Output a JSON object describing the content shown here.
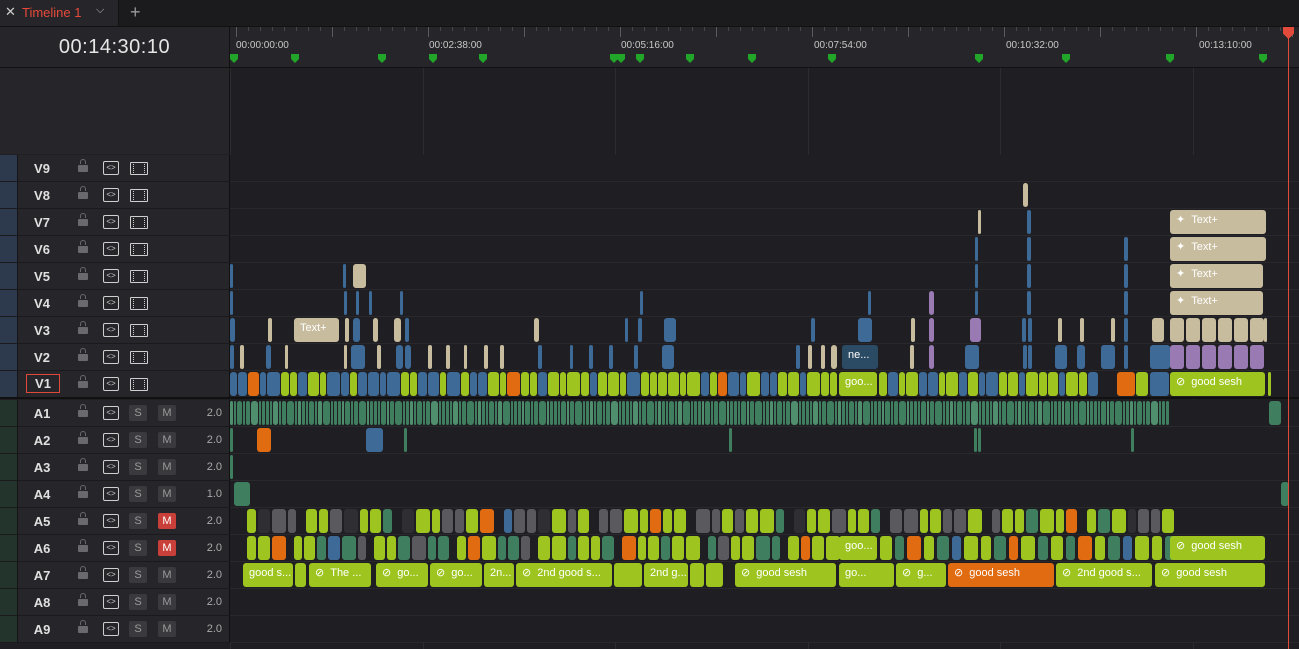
{
  "tab": {
    "close_glyph": "✕",
    "title": "Timeline 1",
    "chevron": "⌵",
    "add": "+"
  },
  "timecode": "00:14:30:10",
  "ruler_labels": [
    "00:00:00:00",
    "00:02:38:00",
    "00:05:16:00",
    "00:07:54:00",
    "00:10:32:00",
    "00:13:10:00"
  ],
  "colors": {
    "accent_red": "#e24a3c",
    "marker_green": "#21a62a",
    "lime": "#9ec51f",
    "blue": "#3d6a96",
    "orange": "#e06b10",
    "beige": "#c8bc9e",
    "purple": "#9a7ab2",
    "audio_green": "#3f7e5f"
  },
  "video_tracks": [
    {
      "name": "V9"
    },
    {
      "name": "V8"
    },
    {
      "name": "V7"
    },
    {
      "name": "V6"
    },
    {
      "name": "V5"
    },
    {
      "name": "V4"
    },
    {
      "name": "V3"
    },
    {
      "name": "V2"
    },
    {
      "name": "V1",
      "selected": true
    }
  ],
  "audio_tracks": [
    {
      "name": "A1",
      "solo": "S",
      "mute": "M",
      "muted": false,
      "level": "2.0"
    },
    {
      "name": "A2",
      "solo": "S",
      "mute": "M",
      "muted": false,
      "level": "2.0"
    },
    {
      "name": "A3",
      "solo": "S",
      "mute": "M",
      "muted": false,
      "level": "2.0"
    },
    {
      "name": "A4",
      "solo": "S",
      "mute": "M",
      "muted": false,
      "level": "1.0"
    },
    {
      "name": "A5",
      "solo": "S",
      "mute": "M",
      "muted": true,
      "level": "2.0"
    },
    {
      "name": "A6",
      "solo": "S",
      "mute": "M",
      "muted": true,
      "level": "2.0"
    },
    {
      "name": "A7",
      "solo": "S",
      "mute": "M",
      "muted": false,
      "level": "2.0"
    },
    {
      "name": "A8",
      "solo": "S",
      "mute": "M",
      "muted": false,
      "level": "2.0"
    },
    {
      "name": "A9",
      "solo": "S",
      "mute": "M",
      "muted": false,
      "level": "2.0"
    }
  ],
  "clip_labels": {
    "text_plus": "Text+",
    "ne": "ne...",
    "goo": "goo...",
    "good_sesh": "good sesh",
    "good_s": "good s...",
    "the": "The ...",
    "go": "go...",
    "go2": "go...",
    "twon": "2n...",
    "second_good": "2nd good s...",
    "second_g": "2nd g...",
    "go3": "go...",
    "g": "g...",
    "second_good2": "2nd good s...",
    "goo2": "goo..."
  },
  "icons": {
    "lock": "lock-icon",
    "auto_select": "auto-select-icon",
    "video": "film-icon",
    "link": "link-icon",
    "sparkle": "sparkle-icon"
  }
}
